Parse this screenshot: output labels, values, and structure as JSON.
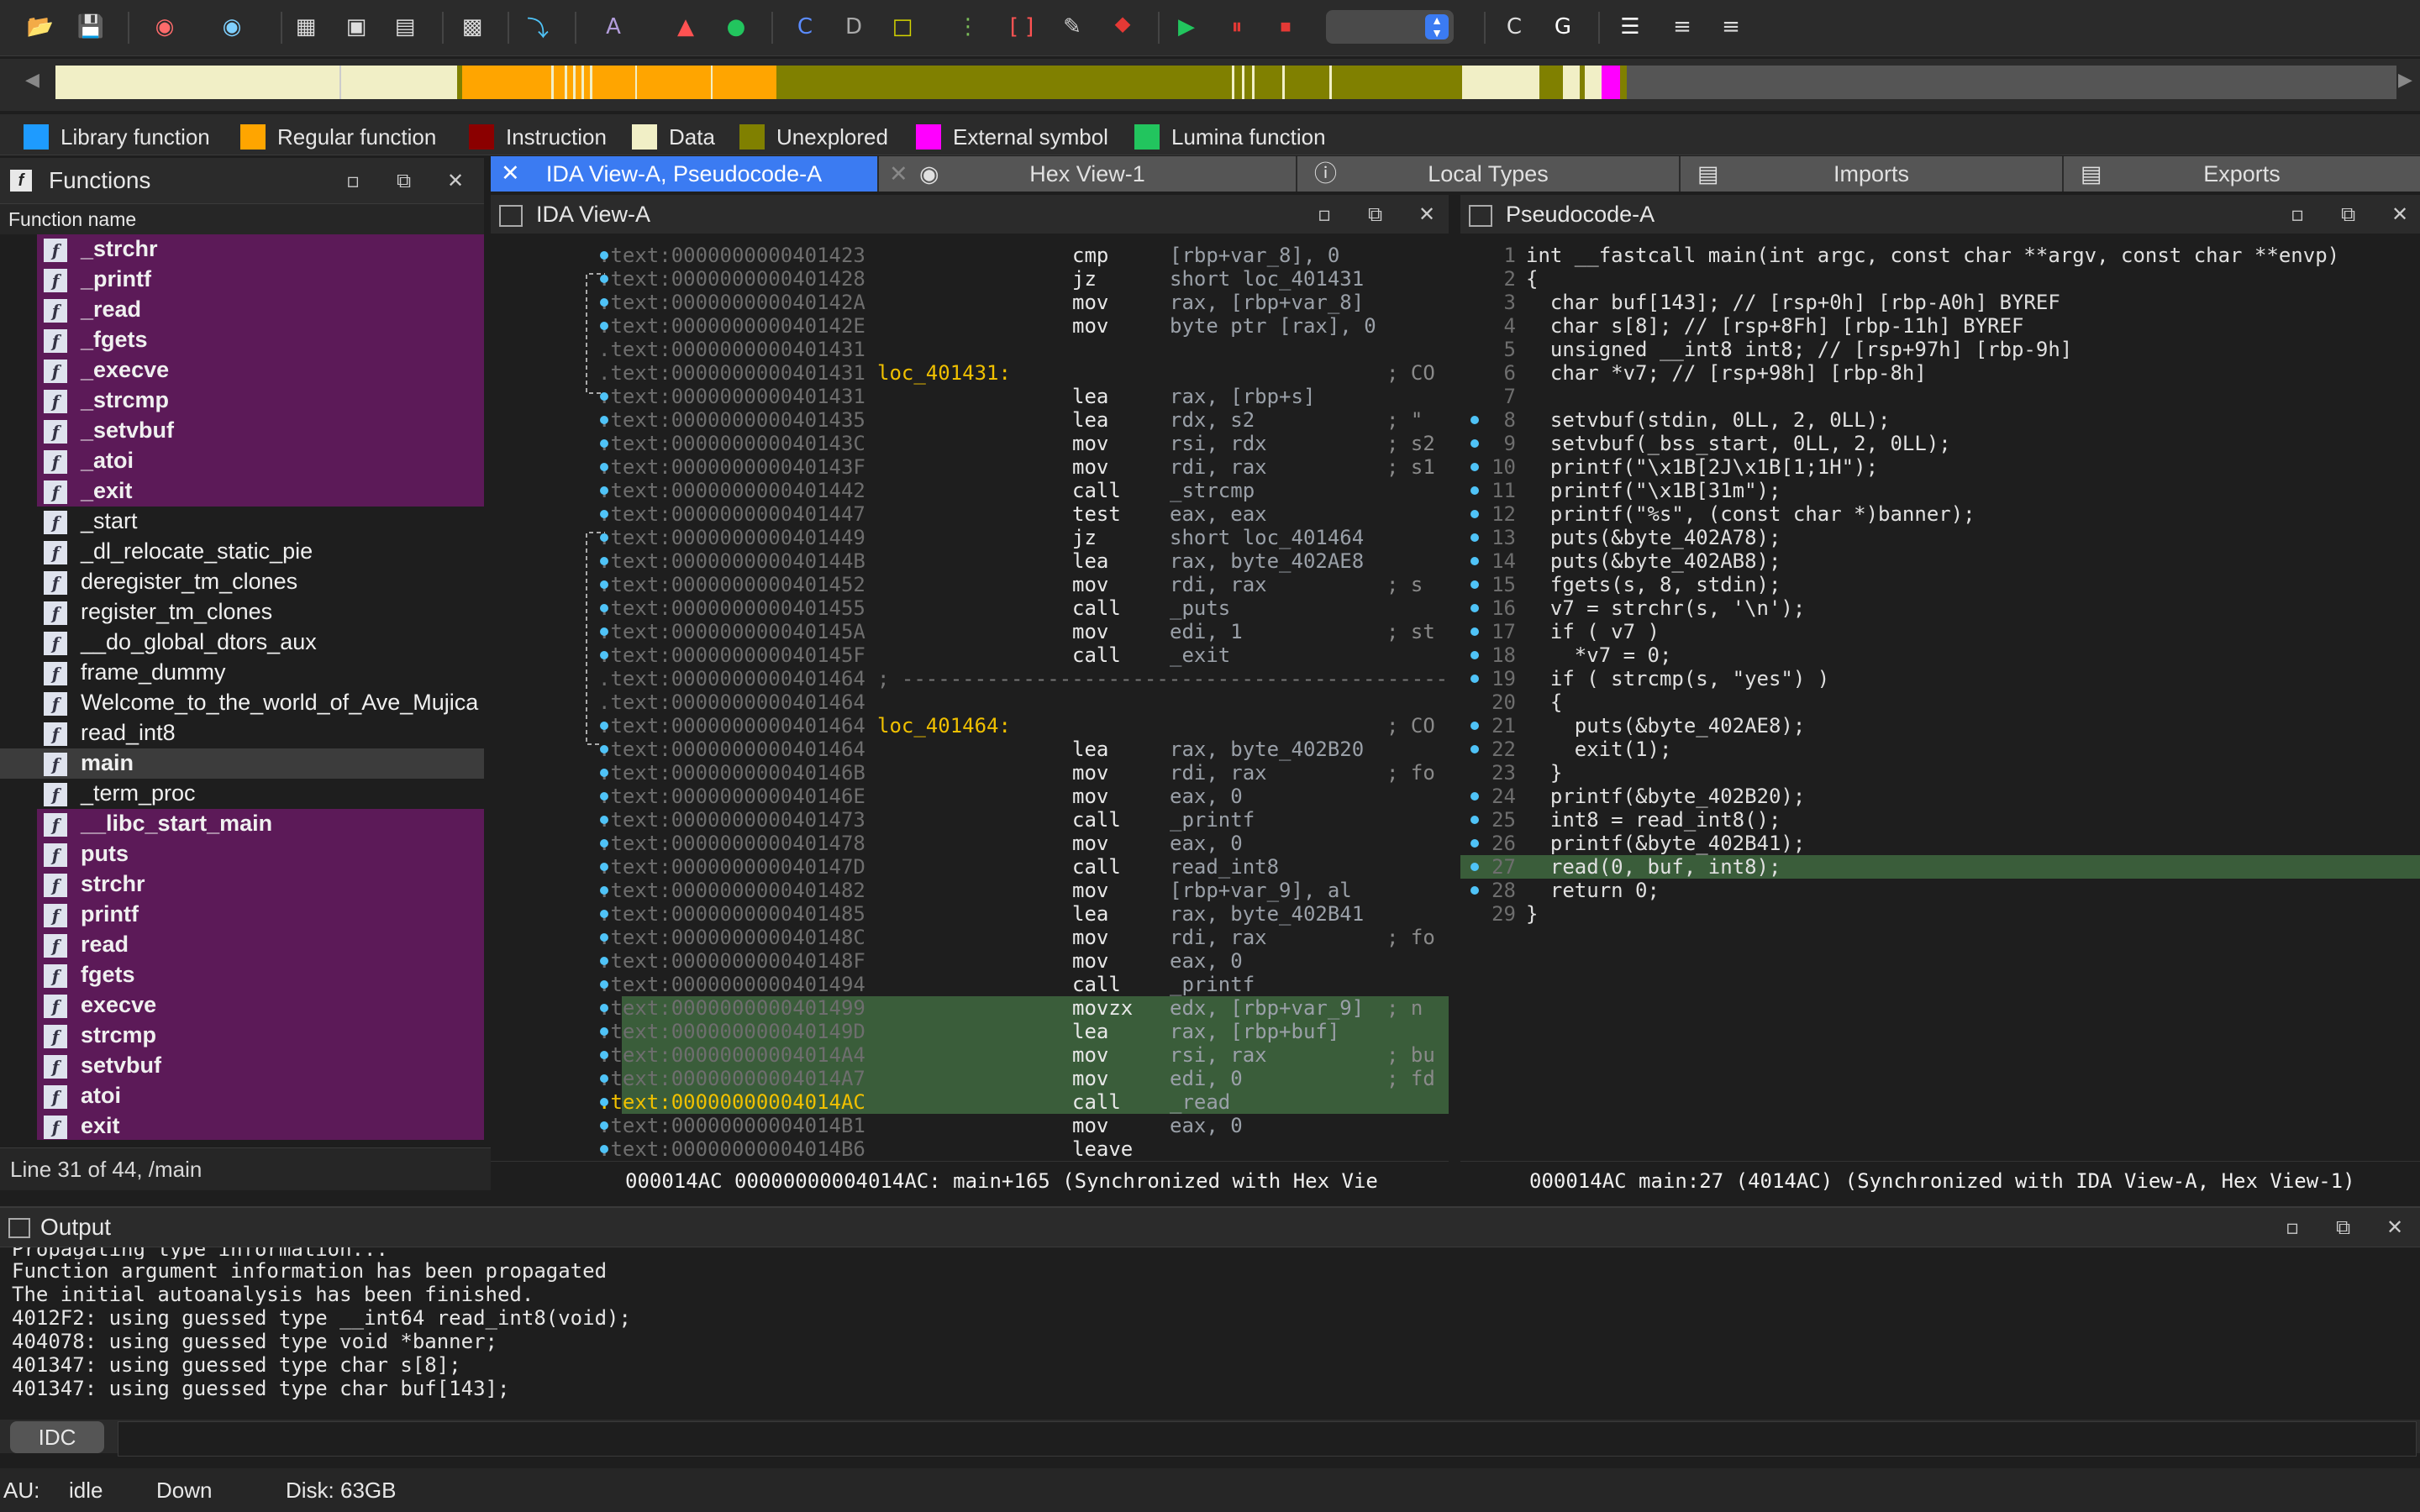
{
  "toolbar": {
    "icons": [
      "open-icon",
      "save-icon",
      "back-icon",
      "forward-icon",
      "graph-icon",
      "text-icon",
      "hex-icon",
      "struct-icon",
      "jump-icon",
      "string-icon",
      "color-icon",
      "run-icon",
      "attach-icon",
      "code-icon",
      "data-icon",
      "undefine-icon",
      "dup-icon",
      "patch-icon",
      "pen-icon",
      "stop-sign-icon",
      "play-icon",
      "pause-icon",
      "stop-icon",
      "cmd-icon",
      "chip-icon",
      "list-icon",
      "list2-icon",
      "list3-icon"
    ]
  },
  "legend": [
    {
      "label": "Library function",
      "color": "#1e9bff"
    },
    {
      "label": "Regular function",
      "color": "#ffa500"
    },
    {
      "label": "Instruction",
      "color": "#8b0000"
    },
    {
      "label": "Data",
      "color": "#f1efc6"
    },
    {
      "label": "Unexplored",
      "color": "#808000"
    },
    {
      "label": "External symbol",
      "color": "#ff00ff"
    },
    {
      "label": "Lumina function",
      "color": "#22c55e"
    }
  ],
  "functions": {
    "title": "Functions",
    "column": "Function name",
    "items": [
      {
        "name": "_strchr",
        "lib": true
      },
      {
        "name": "_printf",
        "lib": true
      },
      {
        "name": "_read",
        "lib": true
      },
      {
        "name": "_fgets",
        "lib": true
      },
      {
        "name": "_execve",
        "lib": true
      },
      {
        "name": "_strcmp",
        "lib": true
      },
      {
        "name": "_setvbuf",
        "lib": true
      },
      {
        "name": "_atoi",
        "lib": true
      },
      {
        "name": "_exit",
        "lib": true
      },
      {
        "name": "_start",
        "lib": false
      },
      {
        "name": "_dl_relocate_static_pie",
        "lib": false
      },
      {
        "name": "deregister_tm_clones",
        "lib": false
      },
      {
        "name": "register_tm_clones",
        "lib": false
      },
      {
        "name": "__do_global_dtors_aux",
        "lib": false
      },
      {
        "name": "frame_dummy",
        "lib": false
      },
      {
        "name": "Welcome_to_the_world_of_Ave_Mujica",
        "lib": false
      },
      {
        "name": "read_int8",
        "lib": false
      },
      {
        "name": "main",
        "lib": false,
        "selected": true
      },
      {
        "name": "_term_proc",
        "lib": false
      },
      {
        "name": "__libc_start_main",
        "lib": true
      },
      {
        "name": "puts",
        "lib": true
      },
      {
        "name": "strchr",
        "lib": true
      },
      {
        "name": "printf",
        "lib": true
      },
      {
        "name": "read",
        "lib": true
      },
      {
        "name": "fgets",
        "lib": true
      },
      {
        "name": "execve",
        "lib": true
      },
      {
        "name": "strcmp",
        "lib": true
      },
      {
        "name": "setvbuf",
        "lib": true
      },
      {
        "name": "atoi",
        "lib": true
      },
      {
        "name": "exit",
        "lib": true
      }
    ],
    "status": "Line 31 of 44, /main"
  },
  "tabs": [
    {
      "label": "IDA View-A, Pseudocode-A",
      "active": true
    },
    {
      "label": "Hex View-1"
    },
    {
      "label": "Local Types"
    },
    {
      "label": "Imports"
    },
    {
      "label": "Exports"
    }
  ],
  "ida_view": {
    "title": "IDA View-A",
    "rows": [
      {
        "addr": ".text:0000000000401423",
        "lbl": "",
        "mn": "cmp",
        "op": "[rbp+var_8], 0",
        "cm": ""
      },
      {
        "addr": ".text:0000000000401428",
        "lbl": "",
        "mn": "jz",
        "op": "short loc_401431",
        "cm": ""
      },
      {
        "addr": ".text:000000000040142A",
        "lbl": "",
        "mn": "mov",
        "op": "rax, [rbp+var_8]",
        "cm": ""
      },
      {
        "addr": ".text:000000000040142E",
        "lbl": "",
        "mn": "mov",
        "op": "byte ptr [rax], 0",
        "cm": ""
      },
      {
        "addr": ".text:0000000000401431",
        "lbl": "",
        "mn": "",
        "op": "",
        "cm": ""
      },
      {
        "addr": ".text:0000000000401431",
        "lbl": "loc_401431:",
        "mn": "",
        "op": "",
        "cm": "; CO"
      },
      {
        "addr": ".text:0000000000401431",
        "lbl": "",
        "mn": "lea",
        "op": "rax, [rbp+s]",
        "cm": ""
      },
      {
        "addr": ".text:0000000000401435",
        "lbl": "",
        "mn": "lea",
        "op": "rdx, s2",
        "cm": "; \""
      },
      {
        "addr": ".text:000000000040143C",
        "lbl": "",
        "mn": "mov",
        "op": "rsi, rdx",
        "cm": "; s2"
      },
      {
        "addr": ".text:000000000040143F",
        "lbl": "",
        "mn": "mov",
        "op": "rdi, rax",
        "cm": "; s1"
      },
      {
        "addr": ".text:0000000000401442",
        "lbl": "",
        "mn": "call",
        "op": "_strcmp",
        "cm": ""
      },
      {
        "addr": ".text:0000000000401447",
        "lbl": "",
        "mn": "test",
        "op": "eax, eax",
        "cm": ""
      },
      {
        "addr": ".text:0000000000401449",
        "lbl": "",
        "mn": "jz",
        "op": "short loc_401464",
        "cm": ""
      },
      {
        "addr": ".text:000000000040144B",
        "lbl": "",
        "mn": "lea",
        "op": "rax, byte_402AE8",
        "cm": ""
      },
      {
        "addr": ".text:0000000000401452",
        "lbl": "",
        "mn": "mov",
        "op": "rdi, rax",
        "cm": "; s"
      },
      {
        "addr": ".text:0000000000401455",
        "lbl": "",
        "mn": "call",
        "op": "_puts",
        "cm": ""
      },
      {
        "addr": ".text:000000000040145A",
        "lbl": "",
        "mn": "mov",
        "op": "edi, 1",
        "cm": "; st"
      },
      {
        "addr": ".text:000000000040145F",
        "lbl": "",
        "mn": "call",
        "op": "_exit",
        "cm": ""
      },
      {
        "addr": ".text:0000000000401464",
        "lbl": "; ----------------------------------------------------------",
        "mn": "",
        "op": "",
        "cm": ""
      },
      {
        "addr": ".text:0000000000401464",
        "lbl": "",
        "mn": "",
        "op": "",
        "cm": ""
      },
      {
        "addr": ".text:0000000000401464",
        "lbl": "loc_401464:",
        "mn": "",
        "op": "",
        "cm": "; CO"
      },
      {
        "addr": ".text:0000000000401464",
        "lbl": "",
        "mn": "lea",
        "op": "rax, byte_402B20",
        "cm": ""
      },
      {
        "addr": ".text:000000000040146B",
        "lbl": "",
        "mn": "mov",
        "op": "rdi, rax",
        "cm": "; fo"
      },
      {
        "addr": ".text:000000000040146E",
        "lbl": "",
        "mn": "mov",
        "op": "eax, 0",
        "cm": ""
      },
      {
        "addr": ".text:0000000000401473",
        "lbl": "",
        "mn": "call",
        "op": "_printf",
        "cm": ""
      },
      {
        "addr": ".text:0000000000401478",
        "lbl": "",
        "mn": "mov",
        "op": "eax, 0",
        "cm": ""
      },
      {
        "addr": ".text:000000000040147D",
        "lbl": "",
        "mn": "call",
        "op": "read_int8",
        "cm": ""
      },
      {
        "addr": ".text:0000000000401482",
        "lbl": "",
        "mn": "mov",
        "op": "[rbp+var_9], al",
        "cm": ""
      },
      {
        "addr": ".text:0000000000401485",
        "lbl": "",
        "mn": "lea",
        "op": "rax, byte_402B41",
        "cm": ""
      },
      {
        "addr": ".text:000000000040148C",
        "lbl": "",
        "mn": "mov",
        "op": "rdi, rax",
        "cm": "; fo"
      },
      {
        "addr": ".text:000000000040148F",
        "lbl": "",
        "mn": "mov",
        "op": "eax, 0",
        "cm": ""
      },
      {
        "addr": ".text:0000000000401494",
        "lbl": "",
        "mn": "call",
        "op": "_printf",
        "cm": ""
      },
      {
        "addr": ".text:0000000000401499",
        "lbl": "",
        "mn": "movzx",
        "op": "edx, [rbp+var_9]",
        "cm": "; n",
        "hl": true
      },
      {
        "addr": ".text:000000000040149D",
        "lbl": "",
        "mn": "lea",
        "op": "rax, [rbp+buf]",
        "cm": "",
        "hl": true
      },
      {
        "addr": ".text:00000000004014A4",
        "lbl": "",
        "mn": "mov",
        "op": "rsi, rax",
        "cm": "; bu",
        "hl": true
      },
      {
        "addr": ".text:00000000004014A7",
        "lbl": "",
        "mn": "mov",
        "op": "edi, 0",
        "cm": "; fd",
        "hl": true
      },
      {
        "addr": ".text:00000000004014AC",
        "lbl": "",
        "mn": "call",
        "op": "_read",
        "cm": "",
        "hl": true,
        "cur": true
      },
      {
        "addr": ".text:00000000004014B1",
        "lbl": "",
        "mn": "mov",
        "op": "eax, 0",
        "cm": ""
      },
      {
        "addr": ".text:00000000004014B6",
        "lbl": "",
        "mn": "leave",
        "op": "",
        "cm": ""
      }
    ],
    "status": "000014AC 00000000004014AC: main+165 (Synchronized with Hex Vie"
  },
  "pseudocode": {
    "title": "Pseudocode-A",
    "lines": [
      {
        "n": "1",
        "t": "int __fastcall main(int argc, const char **argv, const char **envp)"
      },
      {
        "n": "2",
        "t": "{"
      },
      {
        "n": "3",
        "t": "  char buf[143]; // [rsp+0h] [rbp-A0h] BYREF",
        "cls": "c-cy"
      },
      {
        "n": "4",
        "t": "  char s[8]; // [rsp+8Fh] [rbp-11h] BYREF",
        "cls": "c-cy"
      },
      {
        "n": "5",
        "t": "  unsigned __int8 int8; // [rsp+97h] [rbp-9h]",
        "cls": "c-cy"
      },
      {
        "n": "6",
        "t": "  char *v7; // [rsp+98h] [rbp-8h]",
        "cls": "c-cy"
      },
      {
        "n": "7",
        "t": ""
      },
      {
        "n": "8",
        "t": "  setvbuf(stdin, 0LL, 2, 0LL);"
      },
      {
        "n": "9",
        "t": "  setvbuf(_bss_start, 0LL, 2, 0LL);"
      },
      {
        "n": "10",
        "t": "  printf(\"\\x1B[2J\\x1B[1;1H\");"
      },
      {
        "n": "11",
        "t": "  printf(\"\\x1B[31m\");"
      },
      {
        "n": "12",
        "t": "  printf(\"%s\", (const char *)banner);"
      },
      {
        "n": "13",
        "t": "  puts(&byte_402A78);"
      },
      {
        "n": "14",
        "t": "  puts(&byte_402AB8);"
      },
      {
        "n": "15",
        "t": "  fgets(s, 8, stdin);"
      },
      {
        "n": "16",
        "t": "  v7 = strchr(s, '\\n');"
      },
      {
        "n": "17",
        "t": "  if ( v7 )"
      },
      {
        "n": "18",
        "t": "    *v7 = 0;"
      },
      {
        "n": "19",
        "t": "  if ( strcmp(s, \"yes\") )"
      },
      {
        "n": "20",
        "t": "  {"
      },
      {
        "n": "21",
        "t": "    puts(&byte_402AE8);"
      },
      {
        "n": "22",
        "t": "    exit(1);"
      },
      {
        "n": "23",
        "t": "  }"
      },
      {
        "n": "24",
        "t": "  printf(&byte_402B20);"
      },
      {
        "n": "25",
        "t": "  int8 = read_int8();"
      },
      {
        "n": "26",
        "t": "  printf(&byte_402B41);"
      },
      {
        "n": "27",
        "t": "  read(0, buf, int8);",
        "hl": true
      },
      {
        "n": "28",
        "t": "  return 0;"
      },
      {
        "n": "29",
        "t": "}"
      }
    ],
    "status": "000014AC main:27 (4014AC) (Synchronized with IDA View-A, Hex View-1)"
  },
  "output": {
    "title": "Output",
    "lines": [
      "Function argument information has been propagated",
      "The initial autoanalysis has been finished.",
      "4012F2: using guessed type __int64 read_int8(void);",
      "404078: using guessed type void *banner;",
      "401347: using guessed type char s[8];",
      "401347: using guessed type char buf[143];"
    ],
    "partial_line": "Propagating type information..."
  },
  "command": {
    "lang": "IDC",
    "value": ""
  },
  "statusbar": {
    "au_label": "AU:",
    "au_state": "idle",
    "direction": "Down",
    "disk": "Disk: 63GB"
  }
}
